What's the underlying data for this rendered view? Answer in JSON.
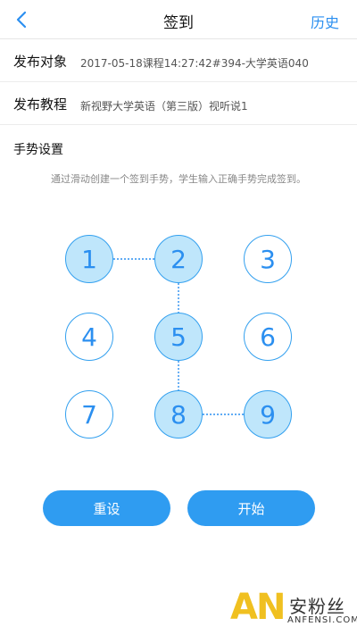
{
  "navbar": {
    "back_icon": "chevron-left-icon",
    "title": "签到",
    "history_label": "历史"
  },
  "publish_target": {
    "label": "发布对象",
    "value": "2017-05-18课程14:27:42#394-大学英语040"
  },
  "publish_course": {
    "label": "发布教程",
    "value": "新视野大学英语（第三版）视听说1"
  },
  "gesture": {
    "title": "手势设置",
    "hint": "通过滑动创建一个签到手势，学生输入正确手势完成签到。",
    "dots": [
      "1",
      "2",
      "3",
      "4",
      "5",
      "6",
      "7",
      "8",
      "9"
    ],
    "selected_path": [
      "1",
      "2",
      "5",
      "8",
      "9"
    ]
  },
  "actions": {
    "reset_label": "重设",
    "start_label": "开始"
  },
  "watermark": {
    "logo_text": "AN",
    "cn_text": "安粉丝",
    "en_text": "ANFENSI.COM"
  },
  "colors": {
    "accent": "#2f9cf1",
    "dot_active_fill": "#bfe6fb",
    "watermark_yellow": "#f0c020"
  }
}
